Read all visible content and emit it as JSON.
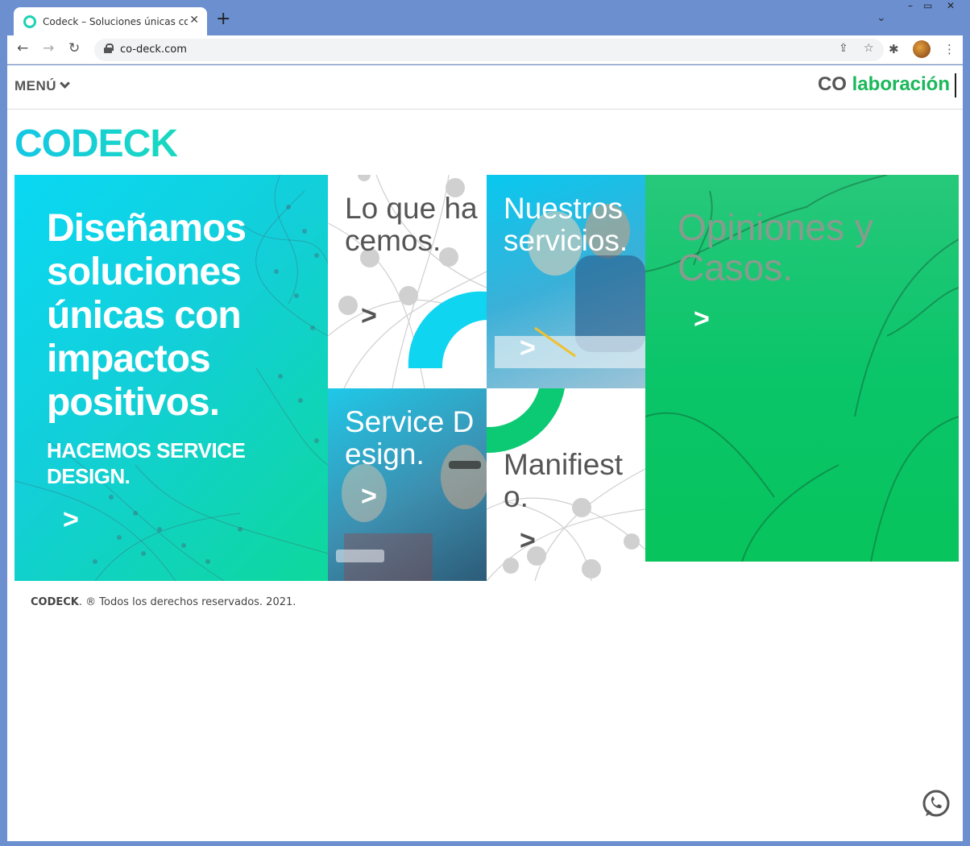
{
  "browser": {
    "tab_title": "Codeck – Soluciones únicas con impactos positivos",
    "tab_close": "✕",
    "new_tab": "+",
    "tab_dropdown": "⌄",
    "url": "co-deck.com",
    "back_icon": "arrow-left",
    "forward_icon": "arrow-right",
    "reload_icon": "reload",
    "window_min": "–",
    "window_max": "▭",
    "window_close": "✕"
  },
  "header": {
    "menu_label": "MENÚ",
    "collab_prefix": "CO",
    "collab_suffix": "laboración"
  },
  "logo": {
    "text": "CODECK"
  },
  "tiles": {
    "hero": {
      "title": "Diseñamos soluciones únicas con impactos positivos.",
      "subtitle": "HACEMOS SERVICE DESIGN.",
      "arrow": ">"
    },
    "lo_que": {
      "title": "Lo que hacemos.",
      "arrow": ">"
    },
    "nuestros": {
      "title": "Nuestros servicios.",
      "arrow": ">"
    },
    "opiniones": {
      "title": "Opiniones y Casos.",
      "arrow": ">"
    },
    "service": {
      "title": "Service Design.",
      "arrow": ">"
    },
    "manifiesto": {
      "title": "Manifiesto.",
      "arrow": ">"
    }
  },
  "footer": {
    "brand": "CODECK",
    "text": ". ® Todos los derechos reservados. 2021."
  },
  "colors": {
    "brand_cyan": "#0ad8f3",
    "brand_green": "#0bc56a",
    "collab_green": "#1ab85a",
    "chrome_blue": "#6b8fcf"
  }
}
